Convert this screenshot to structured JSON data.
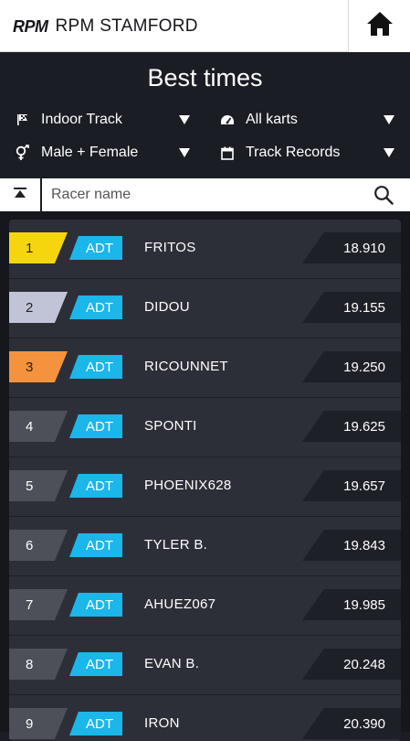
{
  "header": {
    "logo_text": "RPM",
    "venue_name": "RPM STAMFORD",
    "home_icon": "home-icon"
  },
  "page": {
    "title": "Best times"
  },
  "filters": {
    "track": {
      "icon": "flag-icon",
      "label": "Indoor Track"
    },
    "karts": {
      "icon": "gauge-icon",
      "label": "All karts"
    },
    "gender": {
      "icon": "gender-icon",
      "label": "Male + Female"
    },
    "period": {
      "icon": "calendar-icon",
      "label": "Track Records"
    }
  },
  "search": {
    "placeholder": "Racer name",
    "value": ""
  },
  "colors": {
    "gold": "#f5d60e",
    "silver": "#c1c4d6",
    "bronze": "#f5923e",
    "kart_badge": "#1bb6ea",
    "background": "#1b1d25"
  },
  "results": [
    {
      "position": "1",
      "kart": "ADT",
      "name": "FRITOS",
      "time": "18.910"
    },
    {
      "position": "2",
      "kart": "ADT",
      "name": "DIDOU",
      "time": "19.155"
    },
    {
      "position": "3",
      "kart": "ADT",
      "name": "RICOUNNET",
      "time": "19.250"
    },
    {
      "position": "4",
      "kart": "ADT",
      "name": "SPONTI",
      "time": "19.625"
    },
    {
      "position": "5",
      "kart": "ADT",
      "name": "PHOENIX628",
      "time": "19.657"
    },
    {
      "position": "6",
      "kart": "ADT",
      "name": "TYLER B.",
      "time": "19.843"
    },
    {
      "position": "7",
      "kart": "ADT",
      "name": "AHUEZ067",
      "time": "19.985"
    },
    {
      "position": "8",
      "kart": "ADT",
      "name": "EVAN B.",
      "time": "20.248"
    },
    {
      "position": "9",
      "kart": "ADT",
      "name": "IRON",
      "time": "20.390"
    }
  ]
}
